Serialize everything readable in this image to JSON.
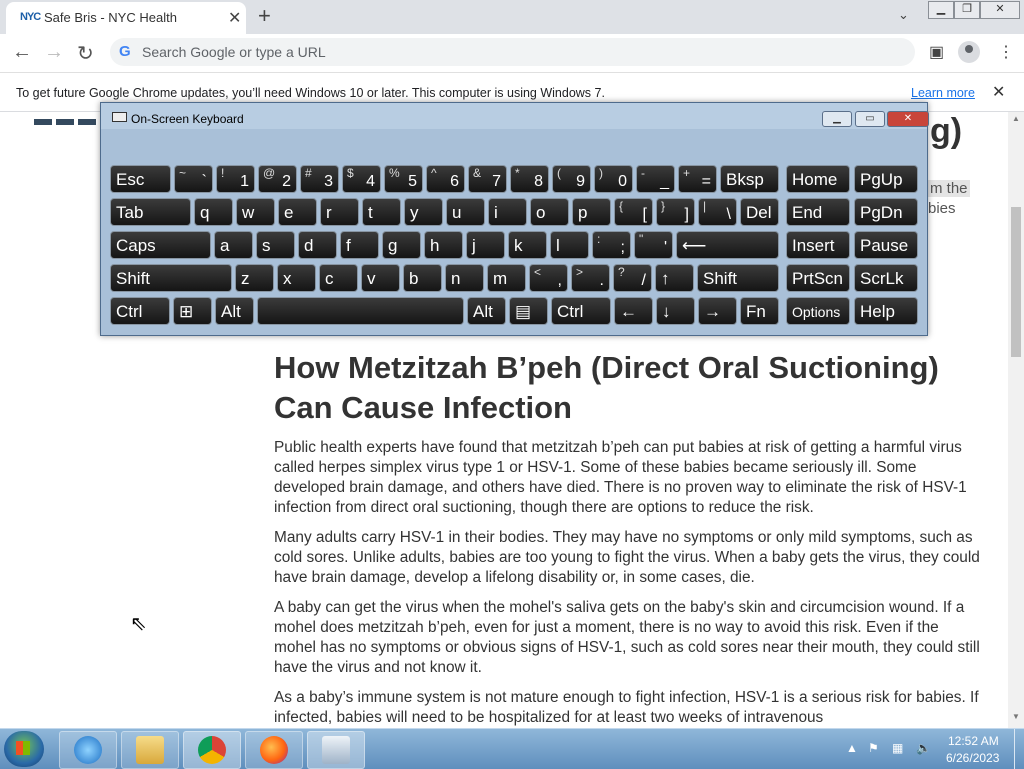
{
  "browser": {
    "tab_title": "Safe Bris - NYC Health",
    "tab_favicon": "NYC",
    "omnibox_placeholder": "Search Google or type a URL",
    "infobar_text": "To get future Google Chrome updates, you’ll need Windows 10 or later. This computer is using Windows 7.",
    "infobar_link": "Learn more"
  },
  "background_fragments": {
    "heading_tail": "g)",
    "line1_tail": "m the",
    "line2_tail": "bies"
  },
  "article": {
    "heading": "How Metzitzah B’peh (Direct Oral Suctioning) Can Cause Infection",
    "paragraphs": [
      "Public health experts have found that metzitzah b’peh can put babies at risk of getting a harmful virus called herpes simplex virus type 1 or HSV-1. Some of these babies became seriously ill. Some developed brain damage, and others have died. There is no proven way to eliminate the risk of HSV-1 infection from direct oral suctioning, though there are options to reduce the risk.",
      "Many adults carry HSV-1 in their bodies. They may have no symptoms or only mild symptoms, such as cold sores. Unlike adults, babies are too young to fight the virus. When a baby gets the virus, they could have brain damage, develop a lifelong disability or, in some cases, die.",
      "A baby can get the virus when the mohel's saliva gets on the baby's skin and circumcision wound. If a mohel does metzitzah b’peh, even for just a moment, there is no way to avoid this risk. Even if the mohel has no symptoms or obvious signs of HSV-1, such as cold sores near their mouth, they could still have the virus and not know it.",
      "As a baby’s immune system is not mature enough to fight infection, HSV-1 is a serious risk for babies. If infected, babies will need to be hospitalized for at least two weeks of intravenous"
    ]
  },
  "osk": {
    "title": "On-Screen Keyboard",
    "keys": {
      "esc": "Esc",
      "bksp": "Bksp",
      "home": "Home",
      "pgup": "PgUp",
      "tab": "Tab",
      "del": "Del",
      "end": "End",
      "pgdn": "PgDn",
      "caps": "Caps",
      "insert": "Insert",
      "pause": "Pause",
      "shift": "Shift",
      "prtscn": "PrtScn",
      "scrlk": "ScrLk",
      "ctrl": "Ctrl",
      "alt": "Alt",
      "fn": "Fn",
      "options": "Options",
      "help": "Help",
      "q": "q",
      "w": "w",
      "e": "e",
      "r": "r",
      "t": "t",
      "y": "y",
      "u": "u",
      "i": "i",
      "o": "o",
      "p": "p",
      "a": "a",
      "s": "s",
      "d": "d",
      "f": "f",
      "g": "g",
      "h": "h",
      "j": "j",
      "k": "k",
      "l": "l",
      "z": "z",
      "x": "x",
      "c": "c",
      "v": "v",
      "b": "b",
      "n": "n",
      "m": "m",
      "n1": "1",
      "n2": "2",
      "n3": "3",
      "n4": "4",
      "n5": "5",
      "n6": "6",
      "n7": "7",
      "n8": "8",
      "n9": "9",
      "n0": "0",
      "s1": "!",
      "s2": "@",
      "s3": "#",
      "s4": "$",
      "s5": "%",
      "s6": "^",
      "s7": "&",
      "s8": "*",
      "s9": "(",
      "s0": ")",
      "tilde_top": "~",
      "tilde_bot": "`",
      "minus_top": "_",
      "minus_bot": "-",
      "plus_top": "+",
      "plus_bot": "=",
      "lbr_top": "{",
      "lbr_bot": "[",
      "rbr_top": "}",
      "rbr_bot": "]",
      "pipe_top": "|",
      "pipe_bot": "\\",
      "colon_top": ":",
      "colon_bot": ";",
      "quote_top": "\"",
      "quote_bot": "'",
      "lt_top": "<",
      "lt_bot": ",",
      "gt_top": ">",
      "gt_bot": ".",
      "q_top": "?",
      "q_bot": "/",
      "enter": "⟵",
      "up": "↑",
      "left": "←",
      "down": "↓",
      "right": "→",
      "win": "⊞",
      "menu": "▤"
    }
  },
  "taskbar": {
    "time": "12:52 AM",
    "date": "6/26/2023"
  }
}
